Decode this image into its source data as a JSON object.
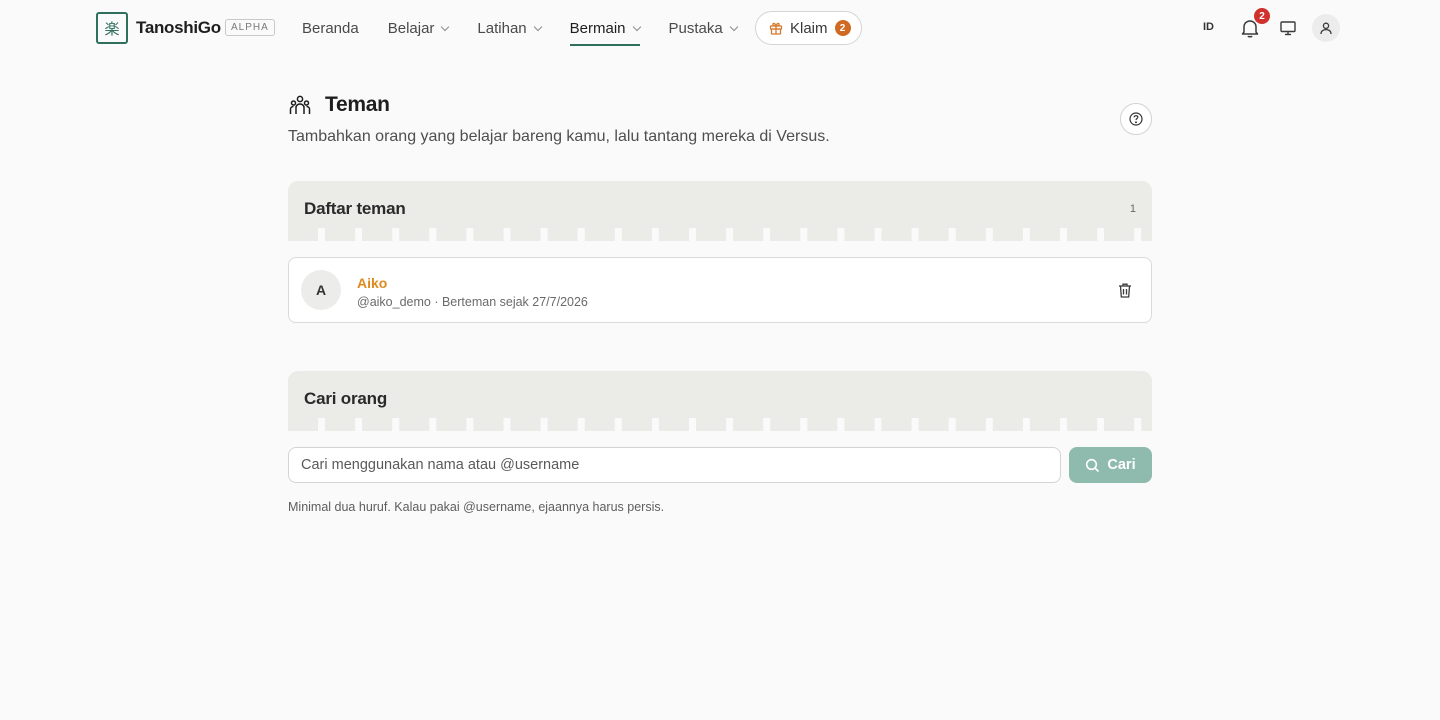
{
  "header": {
    "brand": "TanoshiGo",
    "badge": "ALPHA",
    "nav": [
      {
        "label": "Beranda",
        "has_menu": false,
        "active": false
      },
      {
        "label": "Belajar",
        "has_menu": true,
        "active": false
      },
      {
        "label": "Latihan",
        "has_menu": true,
        "active": false
      },
      {
        "label": "Bermain",
        "has_menu": true,
        "active": true
      },
      {
        "label": "Pustaka",
        "has_menu": true,
        "active": false
      }
    ],
    "claim": {
      "label": "Klaim",
      "count": "2"
    },
    "language": "ID",
    "notifications_count": "2"
  },
  "page": {
    "title": "Teman",
    "subtitle": "Tambahkan orang yang belajar bareng kamu, lalu tantang mereka di Versus."
  },
  "friends_section": {
    "title": "Daftar teman",
    "count": "1",
    "friends": [
      {
        "initial": "A",
        "name": "Aiko",
        "meta": "@aiko_demo · Berteman sejak 27/7/2026"
      }
    ]
  },
  "search_section": {
    "title": "Cari orang",
    "placeholder": "Cari menggunakan nama atau @username",
    "value": "",
    "button_label": "Cari",
    "hint": "Minimal dua huruf. Kalau pakai @username, ejaannya harus persis."
  },
  "colors": {
    "accent": "#2f6f5e",
    "friend_name": "#e08a1e",
    "search_button": "#8fbbae",
    "notification_badge": "#d0312d"
  }
}
